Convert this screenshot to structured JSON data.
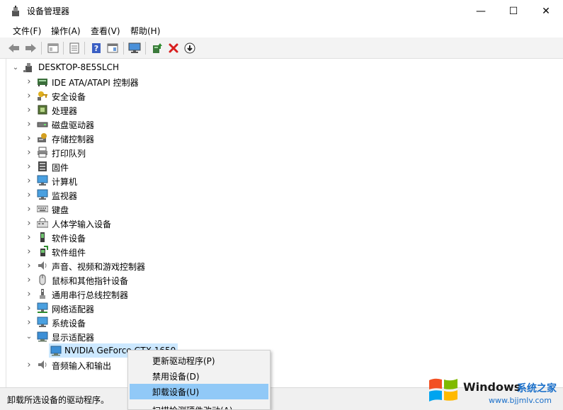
{
  "window": {
    "title": "设备管理器",
    "minimize_glyph": "—",
    "maximize_glyph": "☐",
    "close_glyph": "✕"
  },
  "menu": [
    {
      "label": "文件(F)"
    },
    {
      "label": "操作(A)"
    },
    {
      "label": "查看(V)"
    },
    {
      "label": "帮助(H)"
    }
  ],
  "toolbar": {
    "icons": [
      "back-arrow-icon",
      "forward-arrow-icon",
      "tree-view-icon",
      "properties-icon",
      "help-icon",
      "view-icon",
      "monitor-icon",
      "update-driver-icon",
      "uninstall-x-icon",
      "download-icon"
    ]
  },
  "tree": {
    "root": "DESKTOP-8E5SLCH",
    "categories": [
      {
        "label": "IDE ATA/ATAPI 控制器",
        "icon": "ide-controller-icon",
        "expanded": false
      },
      {
        "label": "安全设备",
        "icon": "security-key-icon",
        "expanded": false
      },
      {
        "label": "处理器",
        "icon": "processor-icon",
        "expanded": false
      },
      {
        "label": "磁盘驱动器",
        "icon": "disk-drive-icon",
        "expanded": false
      },
      {
        "label": "存储控制器",
        "icon": "storage-controller-icon",
        "expanded": false
      },
      {
        "label": "打印队列",
        "icon": "printer-icon",
        "expanded": false
      },
      {
        "label": "固件",
        "icon": "firmware-icon",
        "expanded": false
      },
      {
        "label": "计算机",
        "icon": "computer-icon",
        "expanded": false
      },
      {
        "label": "监视器",
        "icon": "monitor-icon",
        "expanded": false
      },
      {
        "label": "键盘",
        "icon": "keyboard-icon",
        "expanded": false
      },
      {
        "label": "人体学输入设备",
        "icon": "hid-icon",
        "expanded": false
      },
      {
        "label": "软件设备",
        "icon": "software-device-icon",
        "expanded": false
      },
      {
        "label": "软件组件",
        "icon": "software-component-icon",
        "expanded": false
      },
      {
        "label": "声音、视频和游戏控制器",
        "icon": "speaker-icon",
        "expanded": false
      },
      {
        "label": "鼠标和其他指针设备",
        "icon": "mouse-icon",
        "expanded": false
      },
      {
        "label": "通用串行总线控制器",
        "icon": "usb-icon",
        "expanded": false
      },
      {
        "label": "网络适配器",
        "icon": "network-adapter-icon",
        "expanded": false
      },
      {
        "label": "系统设备",
        "icon": "system-device-icon",
        "expanded": false
      },
      {
        "label": "显示适配器",
        "icon": "display-adapter-icon",
        "expanded": true
      },
      {
        "label": "音频输入和输出",
        "icon": "audio-io-icon",
        "expanded": false
      }
    ],
    "display_child": "NVIDIA GeForce GTX 1650"
  },
  "context_menu": {
    "items": [
      {
        "label": "更新驱动程序(P)",
        "highlighted": false
      },
      {
        "label": "禁用设备(D)",
        "highlighted": false
      },
      {
        "label": "卸载设备(U)",
        "highlighted": true
      },
      {
        "label": "扫描检测硬件改动(A)",
        "highlighted": false
      }
    ]
  },
  "status": {
    "text": "卸载所选设备的驱动程序。"
  },
  "watermark": {
    "brand": "Windows",
    "site_name": "系统之家",
    "url": "www.bjjmlv.com"
  },
  "colors": {
    "selection": "#cce8ff",
    "menu_highlight": "#91c9f7",
    "toolbar_bg": "#f3f3f3"
  }
}
